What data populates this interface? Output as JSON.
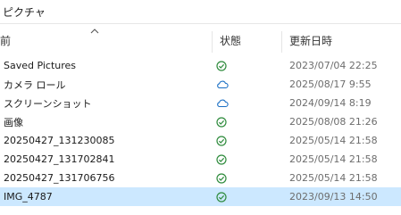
{
  "address": {
    "location": "ピクチャ"
  },
  "columns": {
    "name": "前",
    "status": "状態",
    "date": "更新日時"
  },
  "files": [
    {
      "name": "Saved Pictures",
      "status": "available-locally-icon",
      "date": "2023/07/04 22:25"
    },
    {
      "name": "カメラ ロール",
      "status": "cloud-only-icon",
      "date": "2025/08/17 9:55"
    },
    {
      "name": "スクリーンショット",
      "status": "cloud-only-icon",
      "date": "2024/09/14 8:19"
    },
    {
      "name": "画像",
      "status": "available-locally-icon",
      "date": "2025/08/08 21:26"
    },
    {
      "name": "20250427_131230085",
      "status": "available-locally-icon",
      "date": "2025/05/14 21:58"
    },
    {
      "name": "20250427_131702841",
      "status": "available-locally-icon",
      "date": "2025/05/14 21:58"
    },
    {
      "name": "20250427_131706756",
      "status": "available-locally-icon",
      "date": "2025/05/14 21:58"
    },
    {
      "name": "IMG_4787",
      "status": "available-locally-icon",
      "date": "2023/09/13 14:50",
      "selected": true
    }
  ],
  "colors": {
    "synced": "#2e8b3c",
    "cloud": "#1a6fc4",
    "selection": "#cce8ff"
  }
}
